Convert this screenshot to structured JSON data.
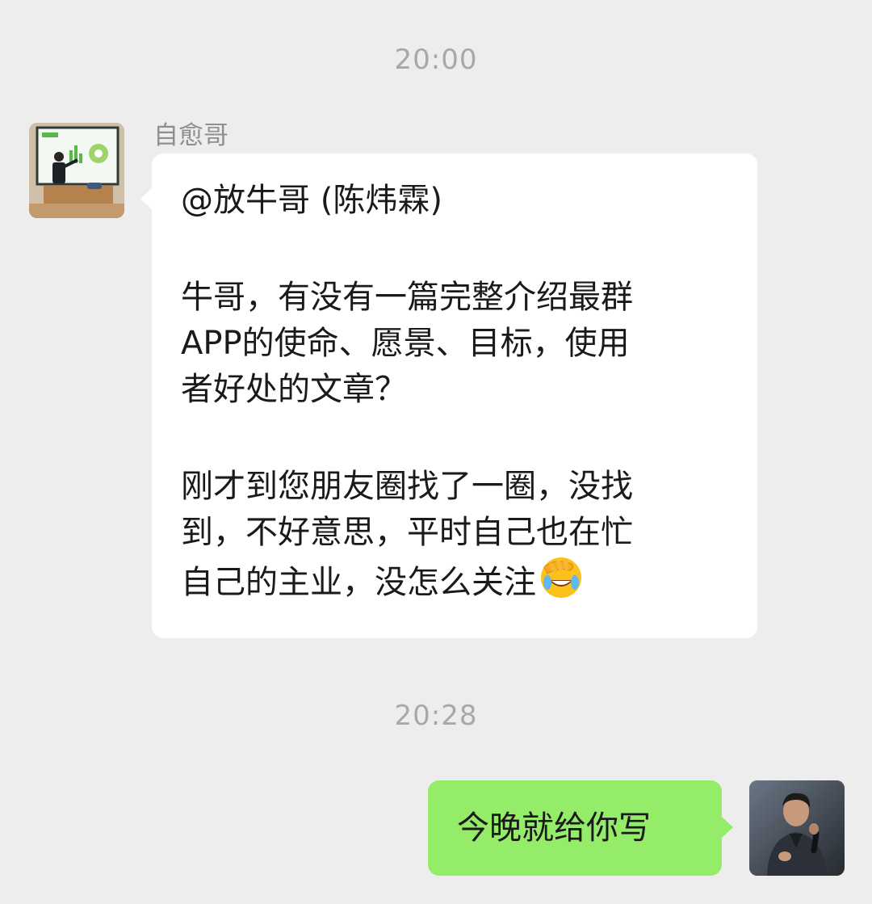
{
  "conversation": {
    "timestamps": [
      "20:00",
      "20:28"
    ],
    "incoming": {
      "sender_name": "自愈哥",
      "avatar": "presenter-in-classroom-avatar",
      "lines": [
        "@放牛哥 (陈炜霖)",
        "牛哥，有没有一篇完整介绍最群",
        "APP的使命、愿景、目标，使用",
        "者好处的文章？",
        "刚才到您朋友圈找了一圈，没找",
        "到，不好意思，平时自己也在忙",
        "自己的主业，没怎么关注"
      ],
      "trailing_emoji": "facepalm-laughing-emoji"
    },
    "outgoing": {
      "avatar": "man-with-microphone-avatar",
      "text": "今晚就给你写"
    }
  },
  "colors": {
    "background": "#ededed",
    "incoming_bubble": "#ffffff",
    "outgoing_bubble": "#95ec69",
    "timestamp_text": "#a8a8a8"
  }
}
